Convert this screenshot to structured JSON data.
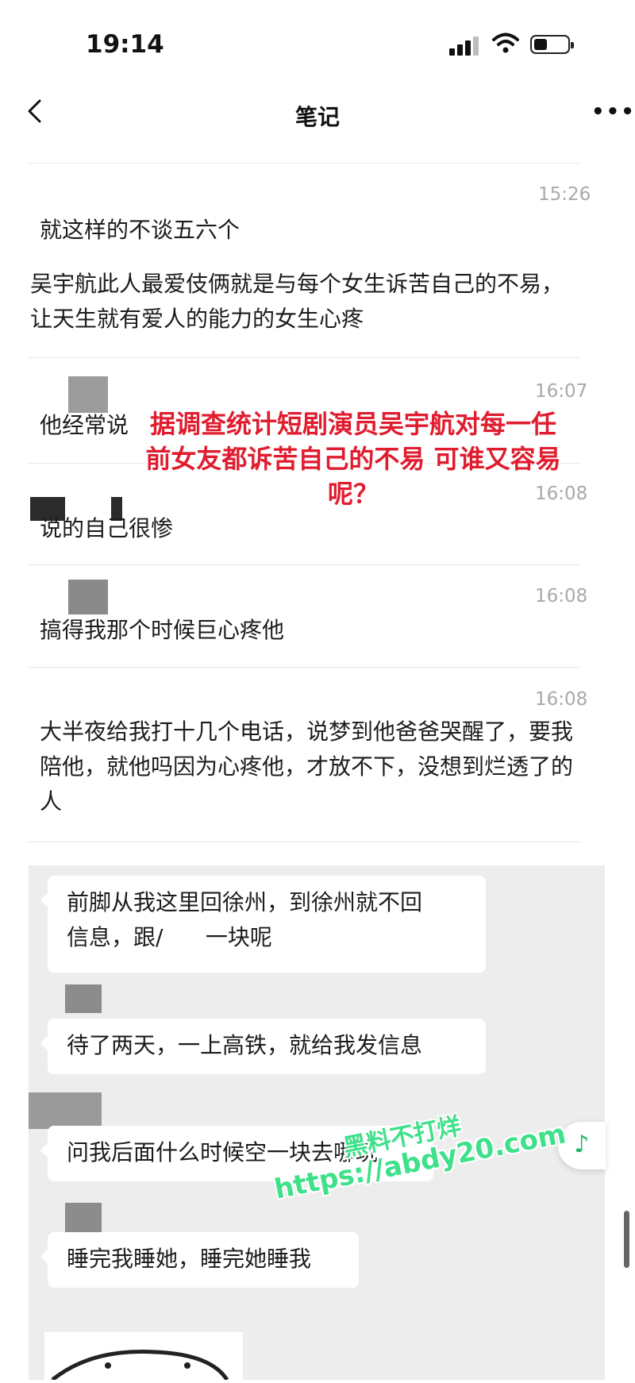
{
  "status": {
    "time": "19:14"
  },
  "nav": {
    "title": "笔记"
  },
  "notes": [
    {
      "time": "15:26",
      "text": "就这样的不谈五六个"
    },
    {
      "time": "",
      "text": "吴宇航此人最爱伎俩就是与每个女生诉苦自己的不易，让天生就有爱人的能力的女生心疼"
    },
    {
      "time": "16:07",
      "text": "他经常说"
    },
    {
      "time": "16:08",
      "text": "说的自己很惨"
    },
    {
      "time": "16:08",
      "text": "搞得我那个时候巨心疼他"
    },
    {
      "time": "16:08",
      "text": "大半夜给我打十几个电话，说梦到他爸爸哭醒了，要我陪他，就他吗因为心疼他，才放不下，没想到烂透了的人"
    }
  ],
  "overlay": {
    "line1": "据调查统计短剧演员吴宇航对每一任",
    "line2": "前女友都诉苦自己的不易 可谁又容易",
    "line3": "呢？",
    "color": "#e01d2f"
  },
  "chat": [
    {
      "line1": "前脚从我这里回徐州，到徐州就不回",
      "line2": "信息，跟/      一块呢"
    },
    {
      "text": "待了两天，一上高铁，就给我发信息"
    },
    {
      "text": "问我后面什么时候空一块去哪玩"
    },
    {
      "text": "睡完我睡她，睡完她睡我"
    }
  ],
  "watermark": {
    "line1": "黑料不打烊",
    "line2": "https://abdy20.com",
    "color": "#3ee08a"
  },
  "music_icon": "music-note-icon"
}
